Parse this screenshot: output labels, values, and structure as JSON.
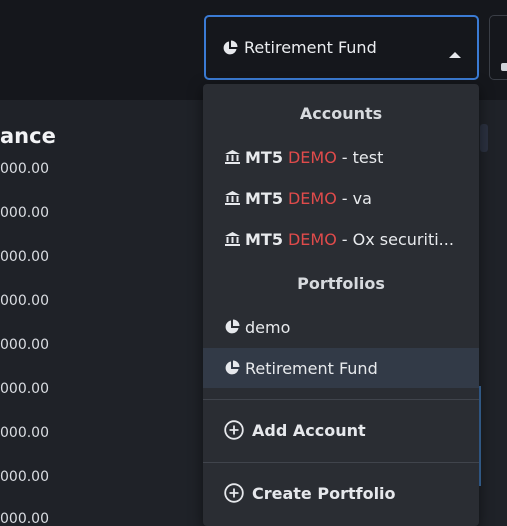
{
  "selector": {
    "label": "Retirement Fund"
  },
  "panel": {
    "title": "ance",
    "amounts": [
      "000.00",
      "000.00",
      "000.00",
      "000.00",
      "000.00",
      "000.00",
      "000.00",
      "000.00",
      "000.00"
    ]
  },
  "menu": {
    "accounts_heading": "Accounts",
    "accounts": [
      {
        "platform": "MT5",
        "tag": "DEMO",
        "name": "- test"
      },
      {
        "platform": "MT5",
        "tag": "DEMO",
        "name": "- va"
      },
      {
        "platform": "MT5",
        "tag": "DEMO",
        "name": "- Ox securiti..."
      }
    ],
    "portfolios_heading": "Portfolios",
    "portfolios": [
      {
        "name": "demo"
      },
      {
        "name": "Retirement Fund"
      }
    ],
    "add_account_label": "Add Account",
    "create_portfolio_label": "Create Portfolio"
  },
  "colors": {
    "accent": "#3b7bd4",
    "demo": "#e04b4b",
    "selected_bg": "#323a47"
  },
  "icons": {
    "portfolio": "pie-chart-icon",
    "account": "bank-icon",
    "add": "plus-circle-icon",
    "caret": "caret-up-icon"
  }
}
